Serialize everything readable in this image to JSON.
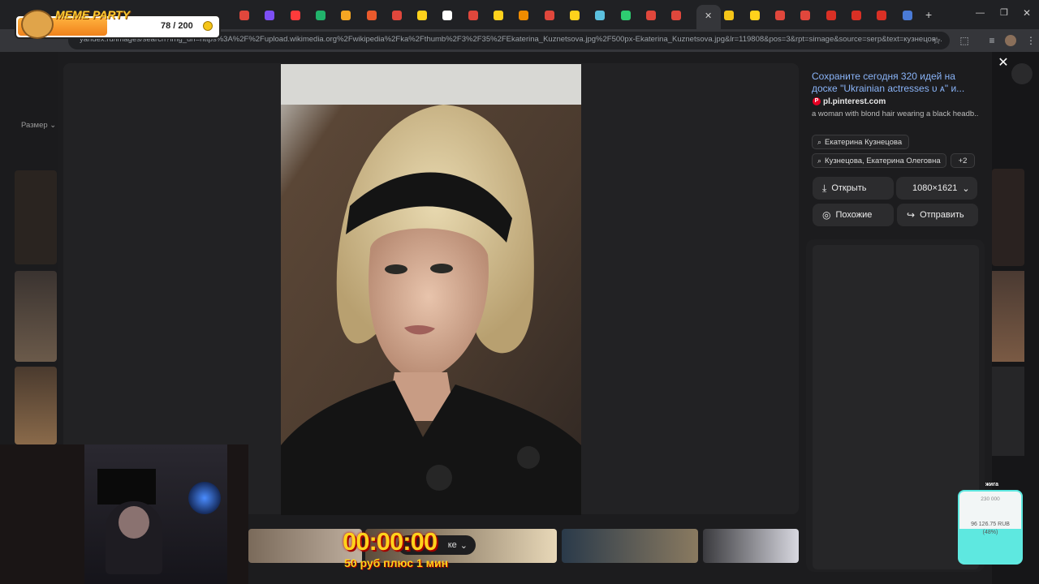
{
  "browser": {
    "url": "yandex.ru/images/search?img_url=https%3A%2F%2Fupload.wikimedia.org%2Fwikipedia%2Fka%2Fthumb%2F3%2F35%2FEkaterina_Kuznetsova.jpg%2F500px-Ekaterina_Kuznetsova.jpg&lr=119808&pos=3&rpt=simage&source=serp&text=кузнецов...",
    "new_tab": "+",
    "tab_colors": [
      "#e0473c",
      "#7d4ff5",
      "#ff3b3b",
      "#21b36b",
      "#f5a623",
      "#ea5a2c",
      "#e0473c",
      "#ffd21c",
      "#ffffff",
      "#e0473c",
      "#ffd21c",
      "#f08c00",
      "#e0473c",
      "#ffd21c",
      "#5bc0de",
      "#2ecc71",
      "#e0473c",
      "#e0473c",
      "#f5c518",
      "#ffd21c",
      "#e0473c",
      "#e0473c",
      "#d93025",
      "#d93025",
      "#d93025",
      "#4a7bd6"
    ]
  },
  "sidebar_left": {
    "size_filter": "Размер"
  },
  "viewer": {
    "close_icon": "close-icon",
    "image_alt": "Екатерина Кузнецова"
  },
  "panel": {
    "title": "Сохраните сегодня 320 идей на доске \"Ukrainian actresses ᴜ ᴀ\" и...",
    "source": "pl.pinterest.com",
    "description": "a woman with blond hair wearing a black headb...",
    "tags": [
      "Екатерина Кузнецова",
      "Кузнецова, Екатерина Олеговна"
    ],
    "more_tags": "+2",
    "open_label": "Открыть",
    "resolution": "1080×1621",
    "similar_label": "Похожие",
    "share_label": "Отправить"
  },
  "strip": {
    "dropdown_label": "ке"
  },
  "overlay": {
    "meme_party_title": "MEME PARTY",
    "meme_party_count": "78 / 200",
    "timer": "00:00:00",
    "timer_sub": "50 руб плюс 1 мин",
    "donation_title": "жига",
    "donation_goal": "230 000",
    "donation_raised": "96 126.75 RUB",
    "donation_percent": "(48%)",
    "donation_fraction": 0.48
  },
  "colors": {
    "accent_link": "#8ab4f8",
    "pinterest": "#e60023",
    "timer": "#ffd21c",
    "donation_bar": "#5ee8e0"
  }
}
